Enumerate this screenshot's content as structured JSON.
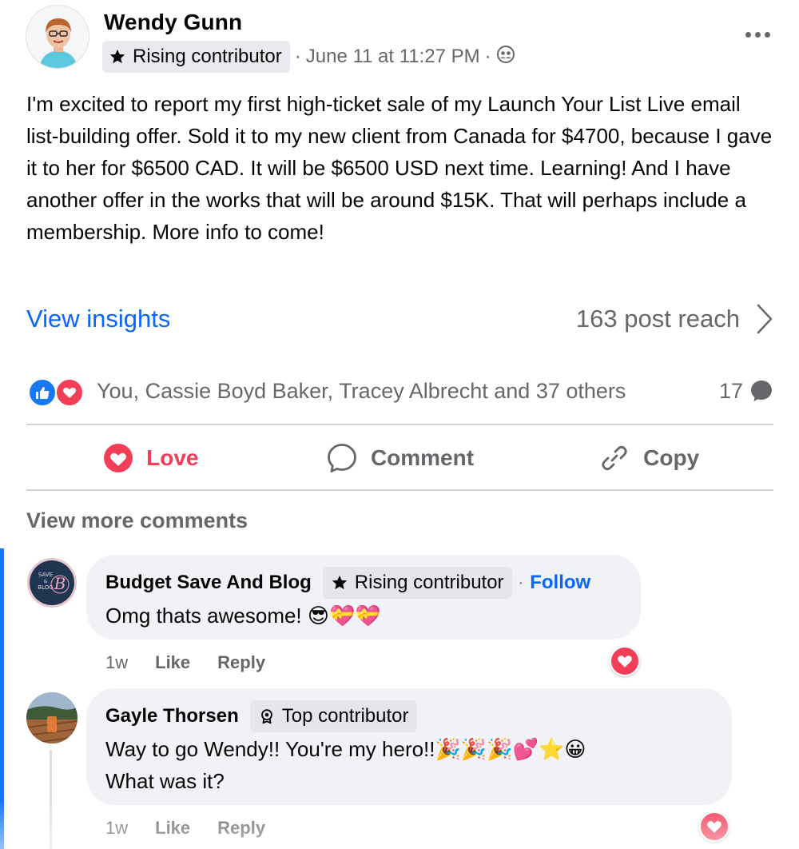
{
  "post": {
    "author": "Wendy Gunn",
    "badge": "Rising contributor",
    "timestamp": "June 11 at 11:27 PM",
    "privacy_icon": "group-icon",
    "body": "I'm excited to report my first high-ticket sale of my Launch Your List Live email list-building offer. Sold it to my new client from Canada for $4700, because I gave it to her for $6500 CAD. It will be $6500 USD next time. Learning! And I have another offer in the works that will be around $15K. That will perhaps include a membership. More info to come!",
    "view_insights": "View insights",
    "reach": "163 post reach",
    "reactors": "You, Cassie Boyd Baker, Tracey Albrecht and 37 others",
    "comment_count": "17"
  },
  "actions": {
    "love": "Love",
    "comment": "Comment",
    "copy": "Copy"
  },
  "comments_section": {
    "view_more": "View more comments"
  },
  "comments": [
    {
      "author": "Budget Save And Blog",
      "badge": "Rising contributor",
      "follow": "Follow",
      "text": "Omg thats awesome! 😎💝💝",
      "time": "1w",
      "like": "Like",
      "reply": "Reply",
      "avatar_text": "SAVE & BLOG"
    },
    {
      "author": "Gayle Thorsen",
      "badge": "Top contributor",
      "text_line1": "Way to go Wendy!! You're my hero!!🎉🎉🎉💕⭐😀",
      "text_line2": "What was it?",
      "time": "1w",
      "like": "Like",
      "reply": "Reply"
    }
  ],
  "colors": {
    "accent_blue": "#0866ff",
    "love_red": "#f33e58",
    "muted_text": "#65676b",
    "bubble_bg": "#f0f2f5"
  }
}
